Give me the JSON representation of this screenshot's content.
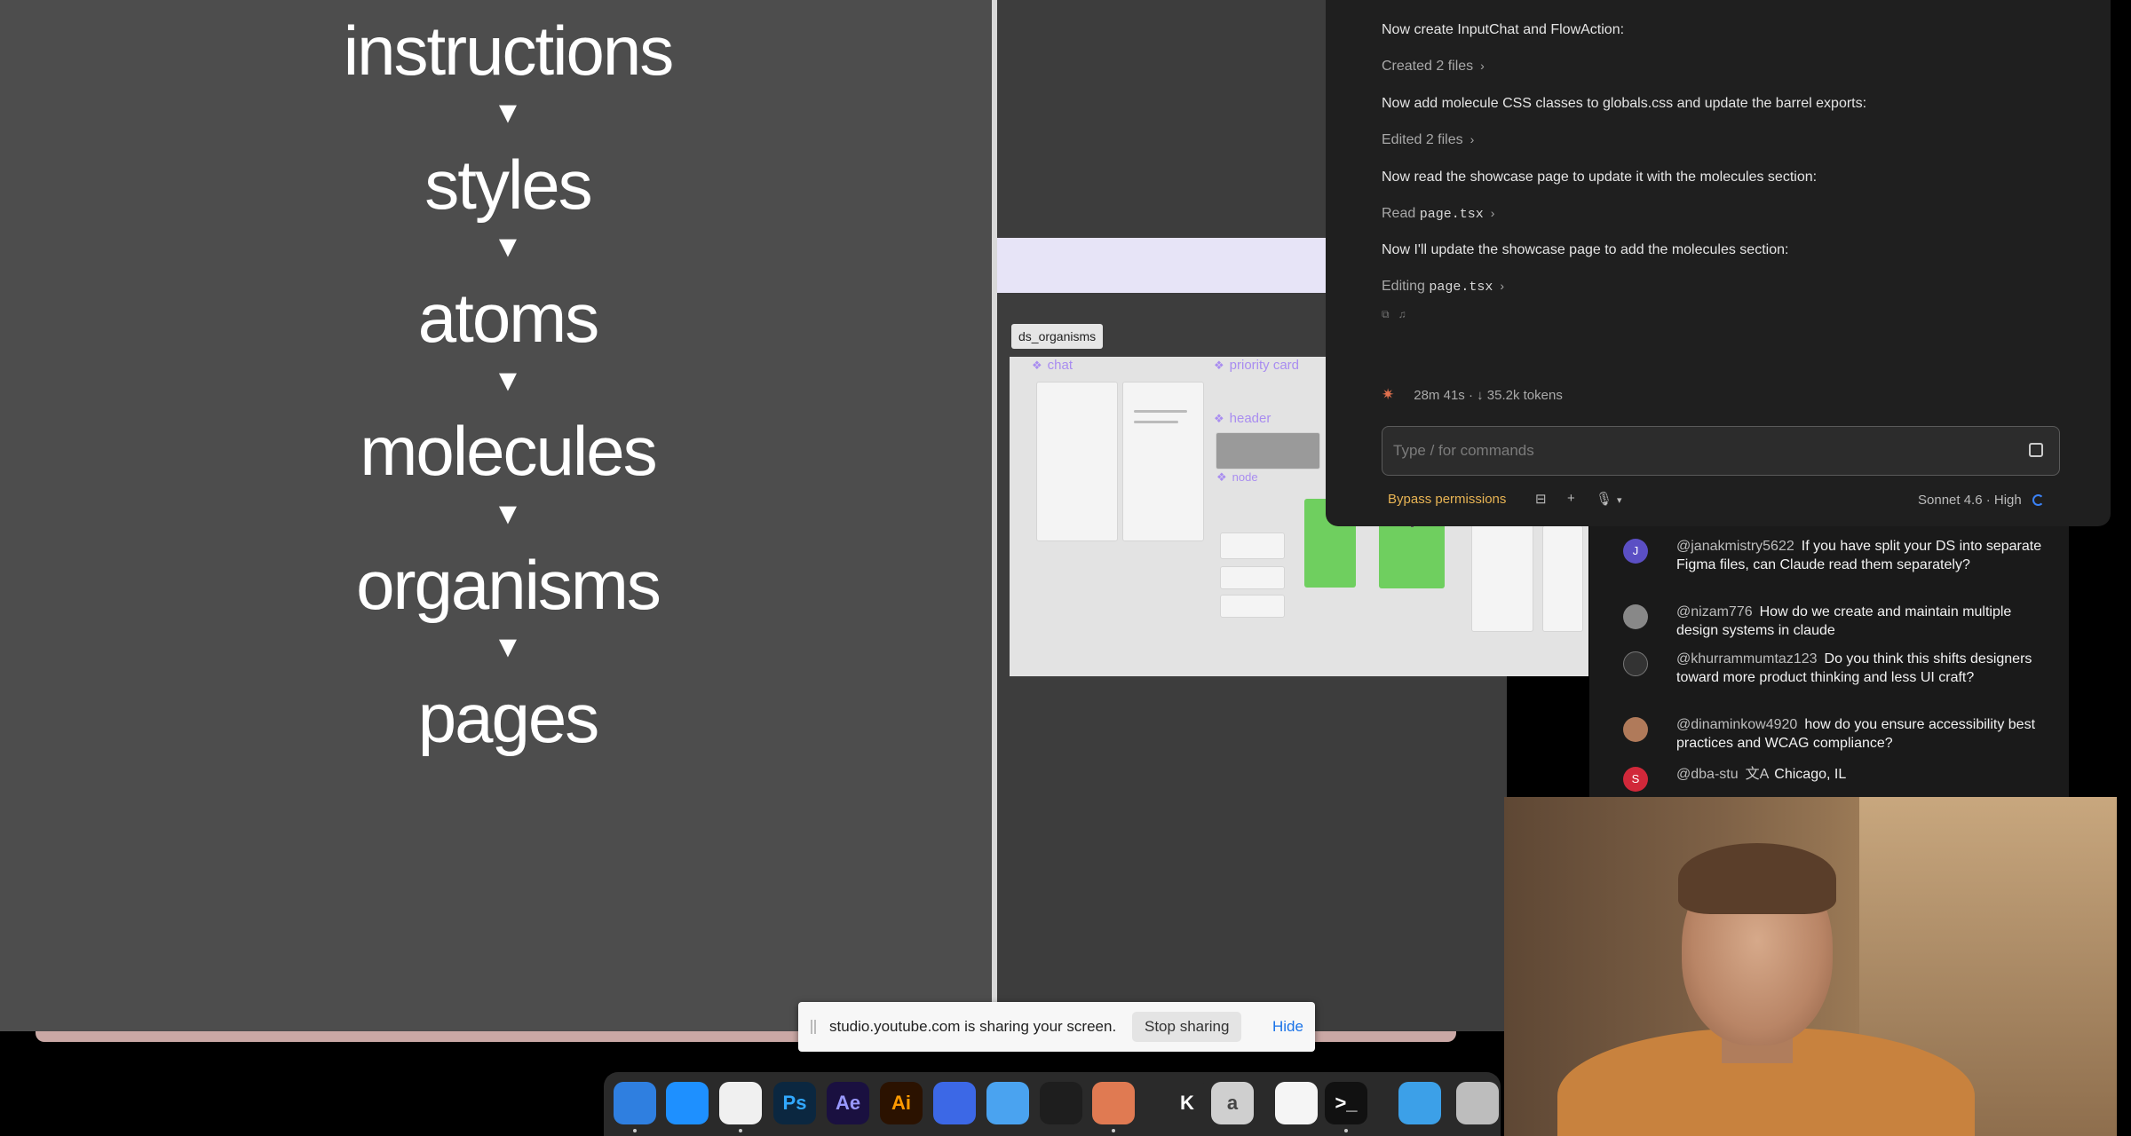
{
  "slide": {
    "levels": [
      "instructions",
      "styles",
      "atoms",
      "molecules",
      "organisms",
      "pages"
    ],
    "arrow": "▼"
  },
  "figma": {
    "frame_label": "ds_organisms",
    "components": [
      "chat",
      "priority card",
      "header",
      "node"
    ]
  },
  "claude": {
    "messages": [
      {
        "text": "Now create InputChat and FlowAction:",
        "kind": "msg"
      },
      {
        "text": "Created 2 files",
        "kind": "sub",
        "file": ""
      },
      {
        "text": "Now add molecule CSS classes to globals.css and update the barrel exports:",
        "kind": "msg"
      },
      {
        "text": "Edited 2 files",
        "kind": "sub",
        "file": ""
      },
      {
        "text": "Now read the showcase page to update it with the molecules section:",
        "kind": "msg"
      },
      {
        "text": "Read",
        "kind": "sub",
        "file": "page.tsx"
      },
      {
        "text": "Now I'll update the showcase page to add the molecules section:",
        "kind": "msg"
      },
      {
        "text": "Editing",
        "kind": "sub",
        "file": "page.tsx"
      }
    ],
    "status": "28m 41s · ↓ 35.2k tokens",
    "input_placeholder": "Type / for commands",
    "footer": {
      "permissions": "Bypass permissions",
      "model": "Sonnet 4.6 · High"
    }
  },
  "chat": [
    {
      "user": "@janakmistry5622",
      "text": "If you have split your DS into separate Figma files, can Claude read them separately?",
      "avatar": "J",
      "color": "#5b4fc4"
    },
    {
      "user": "@nizam776",
      "text": "How do we create and maintain multiple design systems in claude",
      "avatar": "",
      "color": "#888888"
    },
    {
      "user": "@khurrammumtaz123",
      "text": "Do you think this shifts designers toward more product thinking and less UI craft?",
      "avatar": "",
      "color": "#333333"
    },
    {
      "user": "@dinaminkow4920",
      "text": "how do you ensure accessibility best practices and WCAG compliance?",
      "avatar": "",
      "color": "#b07a5a"
    },
    {
      "user": "@dba-stu",
      "text": "Chicago, IL",
      "avatar": "S",
      "color": "#d1283a"
    }
  ],
  "sharing": {
    "message": "studio.youtube.com is sharing your screen.",
    "stop": "Stop sharing",
    "hide": "Hide"
  },
  "dock": [
    {
      "name": "finder",
      "label": "",
      "bg": "#2f7fe0"
    },
    {
      "name": "safari",
      "label": "",
      "bg": "#1e90ff"
    },
    {
      "name": "chrome",
      "label": "",
      "bg": "#f0f0f0"
    },
    {
      "name": "photoshop",
      "label": "Ps",
      "bg": "#0b2740"
    },
    {
      "name": "after-effects",
      "label": "Ae",
      "bg": "#1a1040"
    },
    {
      "name": "illustrator",
      "label": "Ai",
      "bg": "#2b1200"
    },
    {
      "name": "vpn",
      "label": "",
      "bg": "#3c68e6"
    },
    {
      "name": "mail",
      "label": "",
      "bg": "#4aa3f0"
    },
    {
      "name": "figma",
      "label": "",
      "bg": "#1e1e1e"
    },
    {
      "name": "claude",
      "label": "",
      "bg": "#e07a52"
    },
    {
      "name": "kaleidoscope",
      "label": "K",
      "bg": "#2a2a2a"
    },
    {
      "name": "font-app",
      "label": "a",
      "bg": "#cfcfcf"
    },
    {
      "name": "notes",
      "label": "",
      "bg": "#f5f5f5"
    },
    {
      "name": "terminal",
      "label": ">_",
      "bg": "#111111"
    },
    {
      "name": "downloads",
      "label": "",
      "bg": "#3ca0e8"
    },
    {
      "name": "trash",
      "label": "",
      "bg": "#bdbdbd"
    }
  ]
}
